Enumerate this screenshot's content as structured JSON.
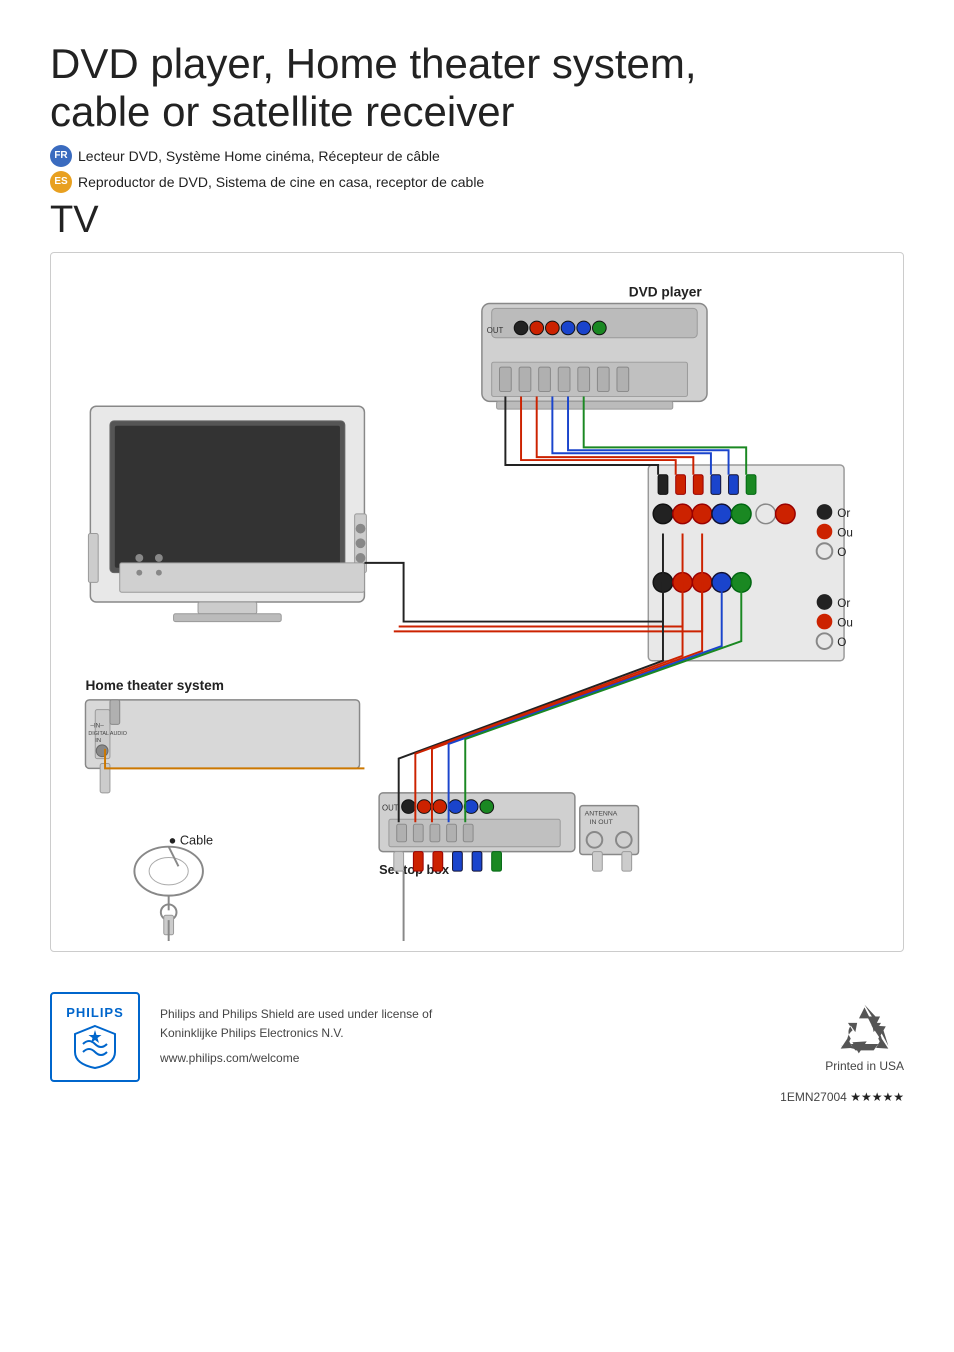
{
  "header": {
    "main_title": "DVD player, Home theater system,\ncable or satellite receiver",
    "subtitle_fr": "Lecteur DVD, Système Home cinéma, Récepteur de câble",
    "subtitle_es": "Reproductor de DVD, Sistema de cine en casa, receptor de cable",
    "badge_fr": "FR",
    "badge_es": "ES",
    "tv_label": "TV"
  },
  "diagram": {
    "dvd_player_label": "DVD player",
    "home_theater_label": "Home theater system",
    "cable_label": "Cable",
    "set_top_box_label": "Set-top box",
    "or_labels": [
      "Or",
      "Ou",
      "O"
    ],
    "digital_audio_label": "IN\nDIGITAL AUDIO\nIN"
  },
  "footer": {
    "brand": "PHILIPS",
    "legal_text": "Philips and Philips Shield are used under license of\nKoninklijke Philips Electronics N.V.",
    "website": "www.philips.com/welcome",
    "printed_label": "Printed in USA",
    "part_number": "1EMN27004",
    "stars": "★★★★★"
  }
}
